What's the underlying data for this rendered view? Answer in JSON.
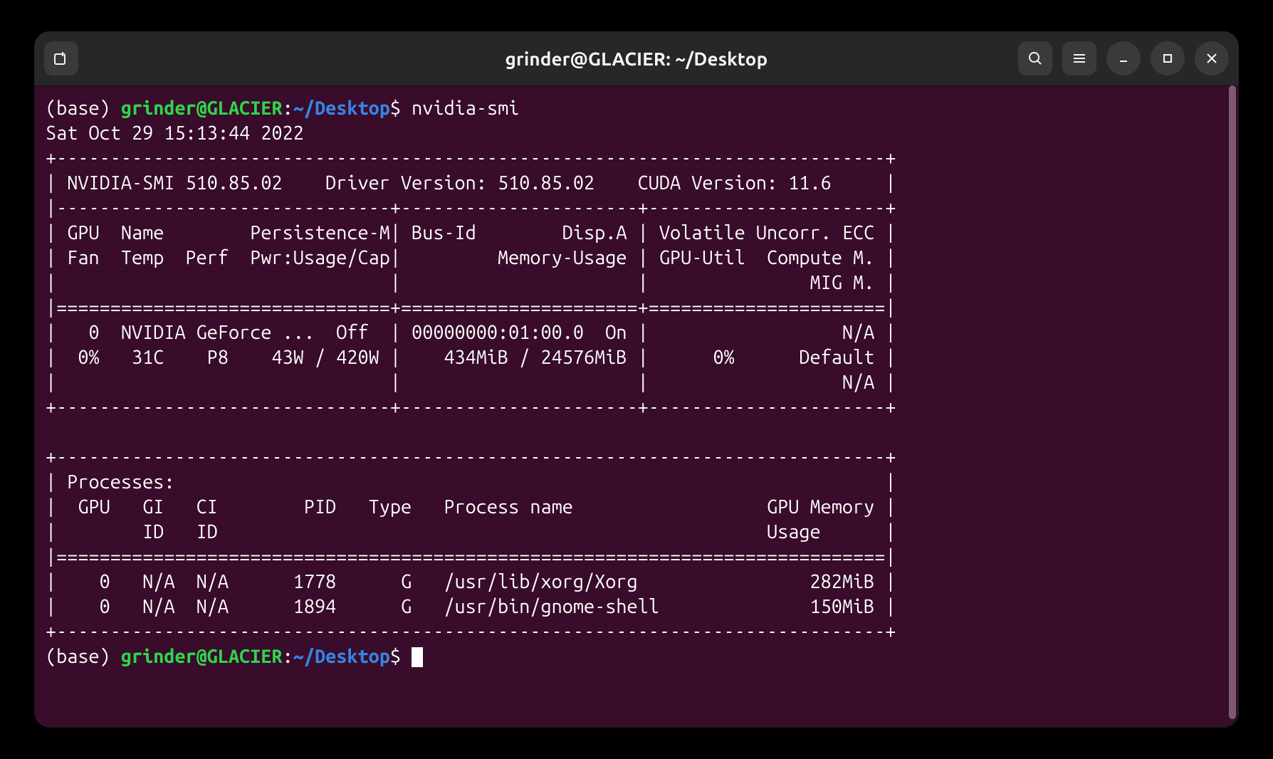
{
  "window": {
    "title": "grinder@GLACIER: ~/Desktop"
  },
  "prompt": {
    "env": "(base) ",
    "user_host": "grinder@GLACIER",
    "colon": ":",
    "path": "~/Desktop",
    "dollar": "$ "
  },
  "command": "nvidia-smi",
  "output": {
    "timestamp": "Sat Oct 29 15:13:44 2022",
    "smi_version_label": "NVIDIA-SMI",
    "smi_version": "510.85.02",
    "driver_version_label": "Driver Version:",
    "driver_version": "510.85.02",
    "cuda_version_label": "CUDA Version:",
    "cuda_version": "11.6",
    "gpu_table": {
      "headers": {
        "gpu": "GPU",
        "name": "Name",
        "persistence": "Persistence-M",
        "bus_id": "Bus-Id",
        "disp_a": "Disp.A",
        "volatile": "Volatile Uncorr. ECC",
        "fan": "Fan",
        "temp": "Temp",
        "perf": "Perf",
        "pwr": "Pwr:Usage/Cap",
        "memory_usage": "Memory-Usage",
        "gpu_util": "GPU-Util",
        "compute_m": "Compute M.",
        "mig_m": "MIG M."
      },
      "rows": [
        {
          "gpu_id": "0",
          "name": "NVIDIA GeForce ...",
          "persistence": "Off",
          "bus_id": "00000000:01:00.0",
          "disp_a": "On",
          "ecc": "N/A",
          "fan": "0%",
          "temp": "31C",
          "perf": "P8",
          "pwr_usage": "43W",
          "pwr_cap": "420W",
          "mem_used": "434MiB",
          "mem_total": "24576MiB",
          "gpu_util": "0%",
          "compute_m": "Default",
          "mig_m": "N/A"
        }
      ]
    },
    "processes_label": "Processes:",
    "proc_headers": {
      "gpu": "GPU",
      "gi_id": "GI",
      "ci_id": "CI",
      "id_sub": "ID",
      "pid": "PID",
      "type": "Type",
      "process_name": "Process name",
      "gpu_memory": "GPU Memory",
      "usage": "Usage"
    },
    "processes": [
      {
        "gpu": "0",
        "gi": "N/A",
        "ci": "N/A",
        "pid": "1778",
        "type": "G",
        "name": "/usr/lib/xorg/Xorg",
        "mem": "282MiB"
      },
      {
        "gpu": "0",
        "gi": "N/A",
        "ci": "N/A",
        "pid": "1894",
        "type": "G",
        "name": "/usr/bin/gnome-shell",
        "mem": "150MiB"
      }
    ]
  },
  "lines": {
    "cmd": "nvidia-smi",
    "ts": "Sat Oct 29 15:13:44 2022       ",
    "dash1": "+-----------------------------------------------------------------------------+",
    "ver": "| NVIDIA-SMI 510.85.02    Driver Version: 510.85.02    CUDA Version: 11.6     |",
    "dash2": "|-------------------------------+----------------------+----------------------+",
    "hdr1": "| GPU  Name        Persistence-M| Bus-Id        Disp.A | Volatile Uncorr. ECC |",
    "hdr2": "| Fan  Temp  Perf  Pwr:Usage/Cap|         Memory-Usage | GPU-Util  Compute M. |",
    "hdr3": "|                               |                      |               MIG M. |",
    "eq1": "|===============================+======================+======================|",
    "row1a": "|   0  NVIDIA GeForce ...  Off  | 00000000:01:00.0  On |                  N/A |",
    "row1b": "|  0%   31C    P8    43W / 420W |    434MiB / 24576MiB |      0%      Default |",
    "row1c": "|                               |                      |                  N/A |",
    "dash3": "+-------------------------------+----------------------+----------------------+",
    "blank": "                                                                               ",
    "dash4": "+-----------------------------------------------------------------------------+",
    "proc1": "| Processes:                                                                  |",
    "proc2": "|  GPU   GI   CI        PID   Type   Process name                  GPU Memory |",
    "proc3": "|        ID   ID                                                   Usage      |",
    "eq2": "|=============================================================================|",
    "p1": "|    0   N/A  N/A      1778      G   /usr/lib/xorg/Xorg                282MiB |",
    "p2": "|    0   N/A  N/A      1894      G   /usr/bin/gnome-shell              150MiB |",
    "dash5": "+-----------------------------------------------------------------------------+"
  }
}
